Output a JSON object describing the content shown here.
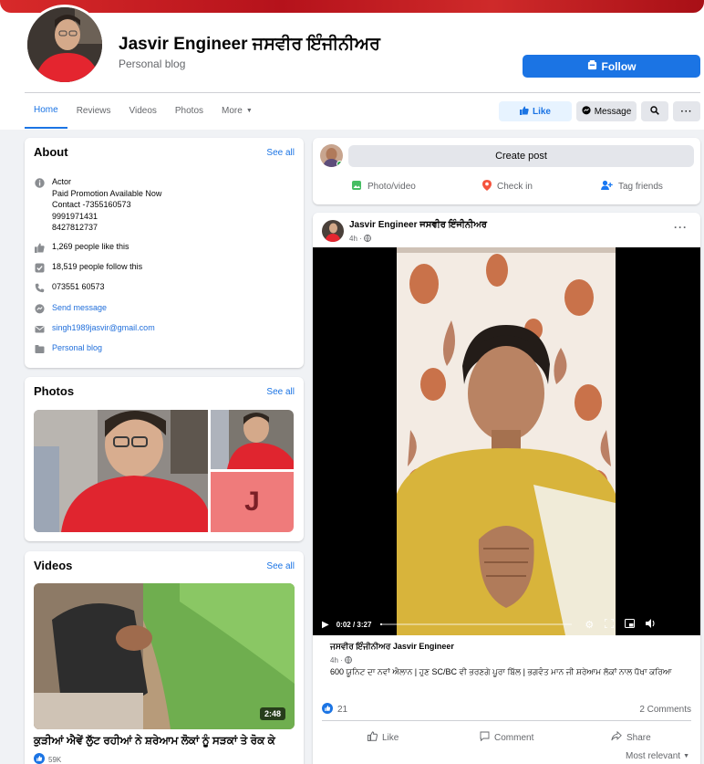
{
  "page": {
    "name": "Jasvir Engineer ਜਸਵੀਰ ਇੰਜੀਨੀਅਰ",
    "category": "Personal blog",
    "follow_label": "Follow"
  },
  "tabs": [
    "Home",
    "Reviews",
    "Videos",
    "Photos",
    "More"
  ],
  "actions": {
    "like": "Like",
    "message": "Message"
  },
  "about": {
    "title": "About",
    "see_all": "See all",
    "intro": [
      "Actor",
      "Paid Promotion Available Now",
      "Contact -7355160573",
      "9991971431",
      "8427812737"
    ],
    "likes": "1,269 people like this",
    "follows": "18,519 people follow this",
    "phone": "073551 60573",
    "send_message": "Send message",
    "email": "singh1989jasvir@gmail.com",
    "category": "Personal blog"
  },
  "photos": {
    "title": "Photos",
    "see_all": "See all",
    "initial": "J"
  },
  "videos": {
    "title": "Videos",
    "see_all": "See all",
    "duration": "2:48",
    "caption": "ਕੁੜੀਆਂ ਐਵੇਂ ਲੁੱਟ ਰਹੀਆਂ ਨੇ ਸ਼ਰੇਆਮ ਲੋਕਾਂ ਨੂੰ ਸੜਕਾਂ ਤੇ ਰੋਕ ਕੇ",
    "views": "59K"
  },
  "composer": {
    "create_post": "Create post",
    "photo_video": "Photo/video",
    "check_in": "Check in",
    "tag_friends": "Tag friends"
  },
  "post": {
    "author": "Jasvir Engineer ਜਸਵੀਰ ਇੰਜੀਨੀਅਰ",
    "time": "4h ·",
    "video_time": "0:02 / 3:27",
    "shared_author": "ਜਸਵੀਰ ਇੰਜੀਨੀਅਰ Jasvir Engineer",
    "shared_time": "4h ·",
    "shared_text": "600 ਯੂਨਿਟ ਦਾ ਨਵਾਂ ਐਲਾਨ | ਹੁਣ SC/BC ਵੀ ਭਰਣਗੇ ਪੂਰਾ ਬਿੱਲ | ਭਗਵੰਤ ਮਾਨ ਜੀ ਸ਼ਰੇਆਮ ਲੋਕਾਂ ਨਾਲ ਧੋਖਾ ਕਰਿਆ",
    "reactions": "21",
    "comments": "2 Comments",
    "like": "Like",
    "comment": "Comment",
    "share": "Share",
    "most_relevant": "Most relevant"
  },
  "colors": {
    "accent": "#1b74e4",
    "cover": "#c8202a",
    "background": "#f0f2f5"
  }
}
